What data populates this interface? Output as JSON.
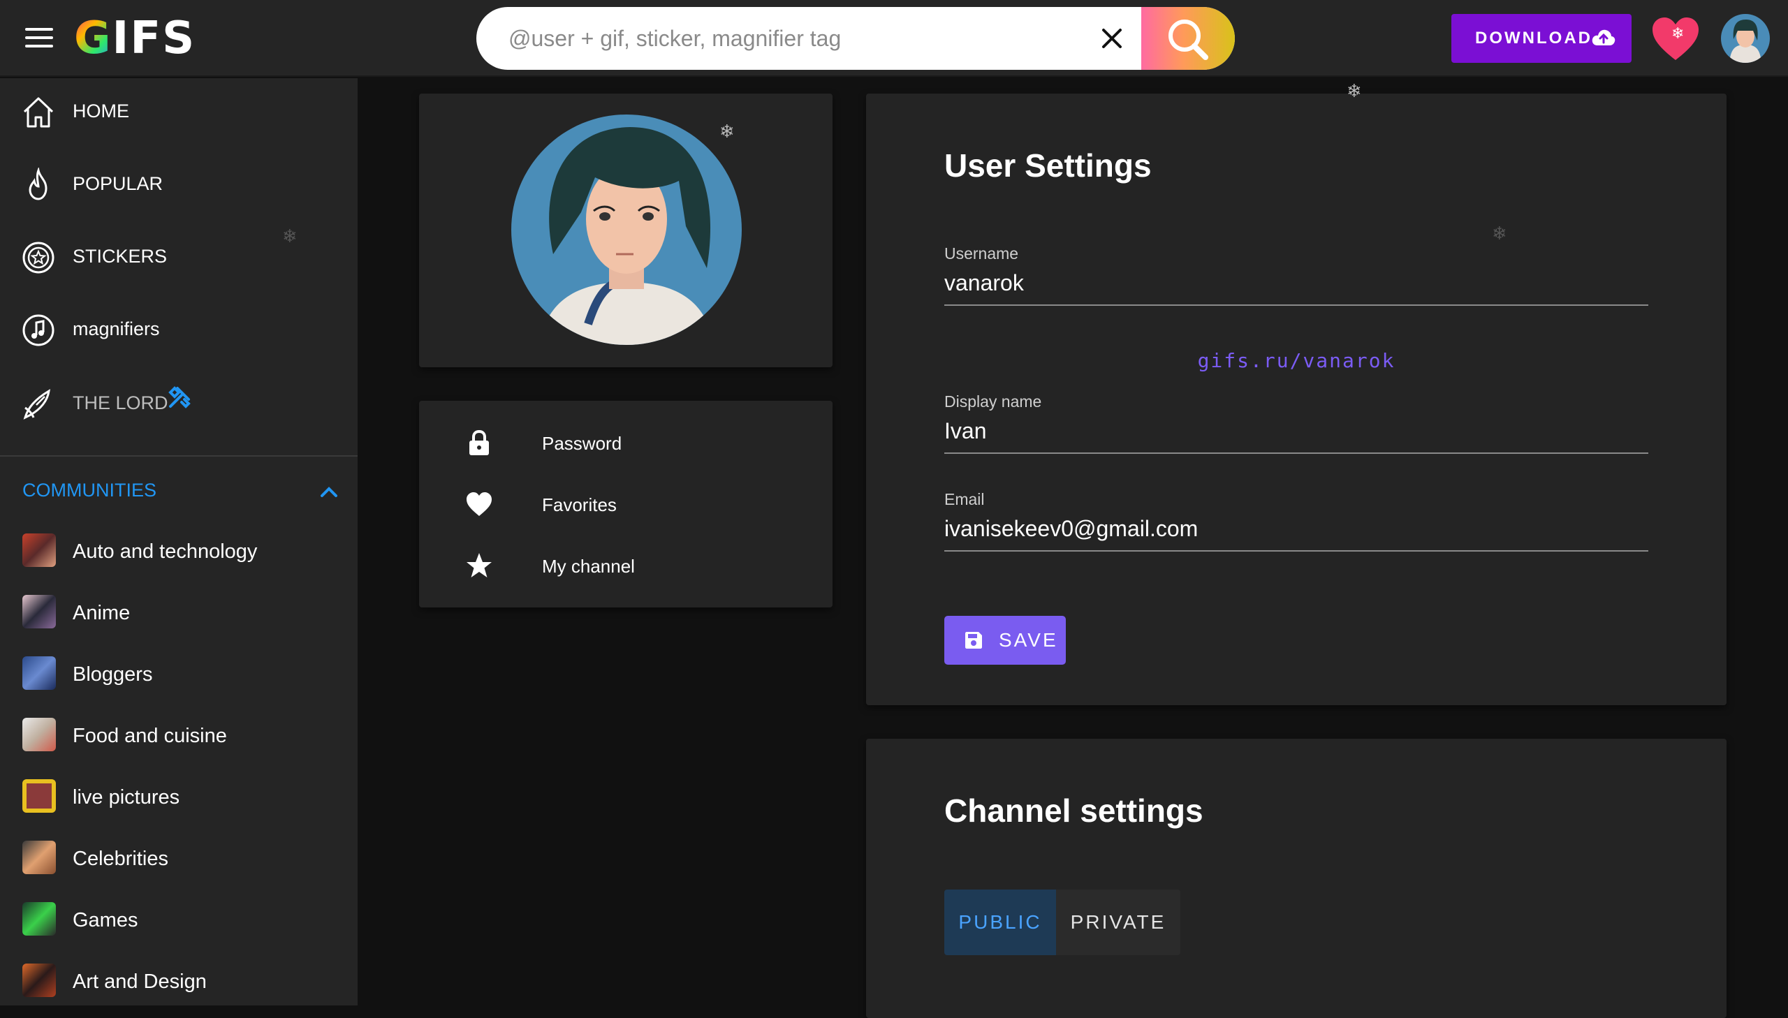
{
  "header": {
    "logo_text_rest": "IFS",
    "logo_text_g": "G",
    "search_placeholder": "@user + gif, sticker, magnifier tag",
    "download_label": "DOWNLOAD"
  },
  "sidebar": {
    "nav": [
      {
        "label": "HOME",
        "icon": "home-icon"
      },
      {
        "label": "POPULAR",
        "icon": "flame-icon"
      },
      {
        "label": "STICKERS",
        "icon": "sticker-icon"
      },
      {
        "label": "magnifiers",
        "icon": "music-note-icon"
      },
      {
        "label": "THE LORD",
        "icon": "brush-icon"
      }
    ],
    "communities_label": "COMMUNITIES",
    "communities": [
      {
        "label": "Auto and technology",
        "color": "#a33a2a"
      },
      {
        "label": "Anime",
        "color": "#6f5a7a"
      },
      {
        "label": "Bloggers",
        "color": "#3c5fa8"
      },
      {
        "label": "Food and cuisine",
        "color": "#cfcfcf"
      },
      {
        "label": "live pictures",
        "color": "#e8c020"
      },
      {
        "label": "Celebrities",
        "color": "#b8824f"
      },
      {
        "label": "Games",
        "color": "#3d8f4a"
      },
      {
        "label": "Art and Design",
        "color": "#c2562a"
      }
    ]
  },
  "profile_menu": {
    "password": "Password",
    "favorites": "Favorites",
    "my_channel": "My channel"
  },
  "user_settings": {
    "title": "User Settings",
    "username_label": "Username",
    "username_value": "vanarok",
    "profile_link": "gifs.ru/vanarok",
    "display_name_label": "Display name",
    "display_name_value": "Ivan",
    "email_label": "Email",
    "email_value": "ivanisekeev0@gmail.com",
    "save_label": "SAVE"
  },
  "channel_settings": {
    "title": "Channel settings",
    "public_label": "PUBLIC",
    "private_label": "PRIVATE",
    "selected": "PUBLIC"
  },
  "colors": {
    "accent_purple": "#7b0fd4",
    "link_purple": "#7b5cf5",
    "communities_blue": "#2196f3",
    "background": "#111111",
    "card": "#242424"
  }
}
